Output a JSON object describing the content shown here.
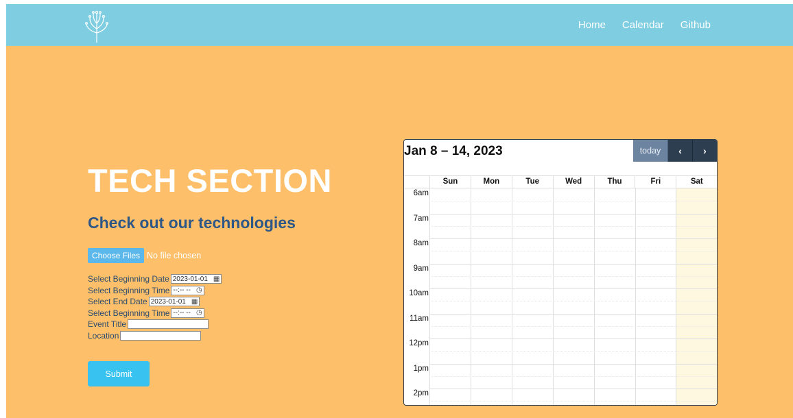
{
  "navbar": {
    "logo": "tree-logo",
    "links": [
      "Home",
      "Calendar",
      "Github"
    ]
  },
  "hero": {
    "title": "TECH SECTION",
    "subtitle": "Check out our technologies"
  },
  "file_input": {
    "button_label": "Choose Files",
    "status": "No file chosen"
  },
  "form": {
    "begin_date_label": "Select Beginning Date",
    "begin_date_value": "2023-01-01",
    "begin_time_label": "Select Beginning Time",
    "begin_time_value": "--:-- --",
    "end_date_label": "Select End Date",
    "end_date_value": "2023-01-01",
    "end_time_label": "Select Beginning Time",
    "end_time_value": "--:-- --",
    "event_title_label": "Event Title",
    "event_title_value": "",
    "location_label": "Location",
    "location_value": "",
    "submit_label": "Submit"
  },
  "calendar": {
    "title": "Jan 8 – 14, 2023",
    "today_label": "today",
    "prev_label": "‹",
    "next_label": "›",
    "days": [
      "Sun",
      "Mon",
      "Tue",
      "Wed",
      "Thu",
      "Fri",
      "Sat"
    ],
    "times": [
      "6am",
      "7am",
      "8am",
      "9am",
      "10am",
      "11am",
      "12pm",
      "1pm",
      "2pm"
    ],
    "highlight_day": "Sat"
  },
  "colors": {
    "navbar": "#7ecde0",
    "page": "#fdbf69",
    "subtitle": "#2c5786",
    "submit": "#37c2ef",
    "calendar_dark": "#2c3e50",
    "today_bg": "#fff8e1"
  }
}
